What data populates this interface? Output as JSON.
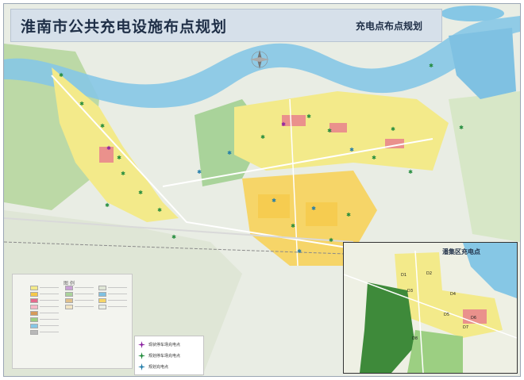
{
  "title": "淮南市公共充电设施布点规划",
  "subtitle": "充电点布点规划",
  "inset": {
    "title": "潘集区充电点",
    "labels": [
      "D1",
      "D2",
      "D3",
      "D4",
      "D5",
      "D6",
      "D7",
      "D8"
    ]
  },
  "legend": {
    "heading": "图  例",
    "items": [
      {
        "label": "现状停车场充电点",
        "color": "#8a1fa0",
        "icon": "star-marker-purple"
      },
      {
        "label": "规划停车场充电点",
        "color": "#1f8a3a",
        "icon": "star-marker-green"
      },
      {
        "label": "规划充电点",
        "color": "#1f7aa8",
        "icon": "star-marker-teal"
      }
    ]
  },
  "colors": {
    "water": "#86c7e5",
    "urban": "#f3ea8a",
    "residential": "#f6c94a",
    "commercial": "#e56b8d",
    "green": "#9ccf82",
    "roads": "#ffffff",
    "header_bg": "#d6e0ea",
    "title_text": "#1f2f47"
  }
}
